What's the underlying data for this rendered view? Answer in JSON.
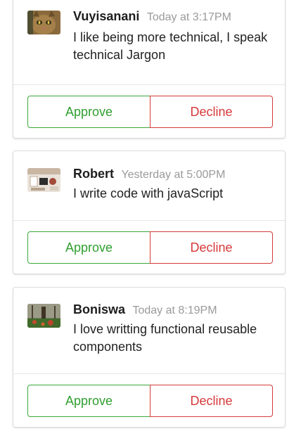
{
  "requests": [
    {
      "author": "Vuyisanani",
      "time": "Today at 3:17PM",
      "message": "I like being more technical, I speak technical Jargon",
      "approve_label": "Approve",
      "decline_label": "Decline",
      "avatar": "cat-photo"
    },
    {
      "author": "Robert",
      "time": "Yesterday at 5:00PM",
      "message": "I write code with javaScript",
      "approve_label": "Approve",
      "decline_label": "Decline",
      "avatar": "desk-photo"
    },
    {
      "author": "Boniswa",
      "time": "Today at 8:19PM",
      "message": "I love writting functional reusable components",
      "approve_label": "Approve",
      "decline_label": "Decline",
      "avatar": "forest-photo"
    }
  ],
  "colors": {
    "approve": "#2f9e2f",
    "decline": "#d63a3a",
    "timestamp": "#9a9a9a"
  }
}
